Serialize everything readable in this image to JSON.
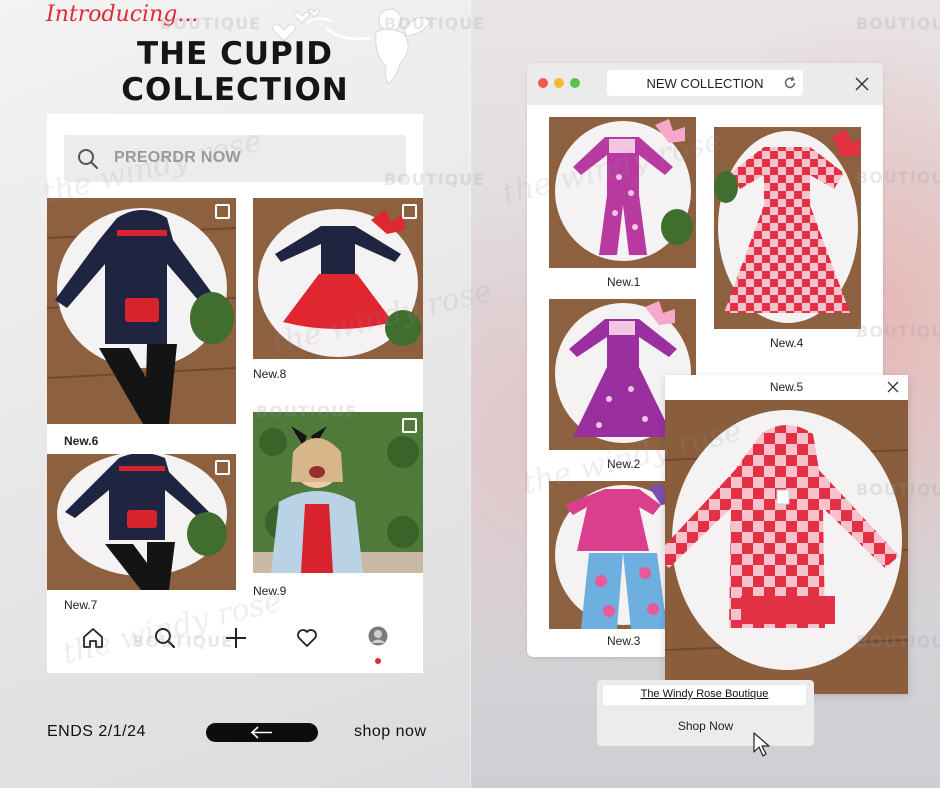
{
  "header": {
    "intro": "Introducing...",
    "title_line1": "THE CUPID",
    "title_line2": "COLLECTION"
  },
  "phone": {
    "search": {
      "placeholder": "PREORDR NOW",
      "icon": "search-icon"
    },
    "posts": [
      {
        "label": "New.6",
        "colors": {
          "base": "#1f2540",
          "accent": "#d8232f"
        }
      },
      {
        "label": "New.7",
        "colors": {
          "base": "#1f2540",
          "accent": "#d8232f"
        }
      },
      {
        "label": "New.8",
        "colors": {
          "base": "#1f2540",
          "accent": "#e0262f"
        }
      },
      {
        "label": "New.9",
        "colors": {
          "base": "#4f7a3a",
          "accent": "#b9d2e6"
        }
      }
    ],
    "nav": [
      "home-icon",
      "search-icon",
      "plus-icon",
      "heart-icon",
      "profile-avatar"
    ]
  },
  "footer": {
    "ends": "ENDS 2/1/24",
    "arrow": "←",
    "shop": "shop now"
  },
  "browser": {
    "url_text": "NEW COLLECTION",
    "traffic_lights": [
      "#ee5a52",
      "#f5b93a",
      "#5cc24a"
    ],
    "items": [
      {
        "label": "New.1",
        "colors": {
          "base": "#b83aa0",
          "accent": "#f2c6e0"
        }
      },
      {
        "label": "New.2",
        "colors": {
          "base": "#9a2fa0",
          "accent": "#f2c6e0"
        }
      },
      {
        "label": "New.3",
        "colors": {
          "base": "#d93f8c",
          "accent": "#6db0e0"
        }
      },
      {
        "label": "New.4",
        "colors": {
          "base": "#e23044",
          "accent": "#f7c2cc"
        }
      }
    ]
  },
  "popup": {
    "title": "New.5",
    "colors": {
      "base": "#e23044",
      "accent": "#f7c2cc"
    }
  },
  "shop_box": {
    "link": "The Windy Rose Boutique",
    "button": "Shop Now"
  },
  "watermark": {
    "script": "the windy rose",
    "word": "BOUTIQUE"
  }
}
